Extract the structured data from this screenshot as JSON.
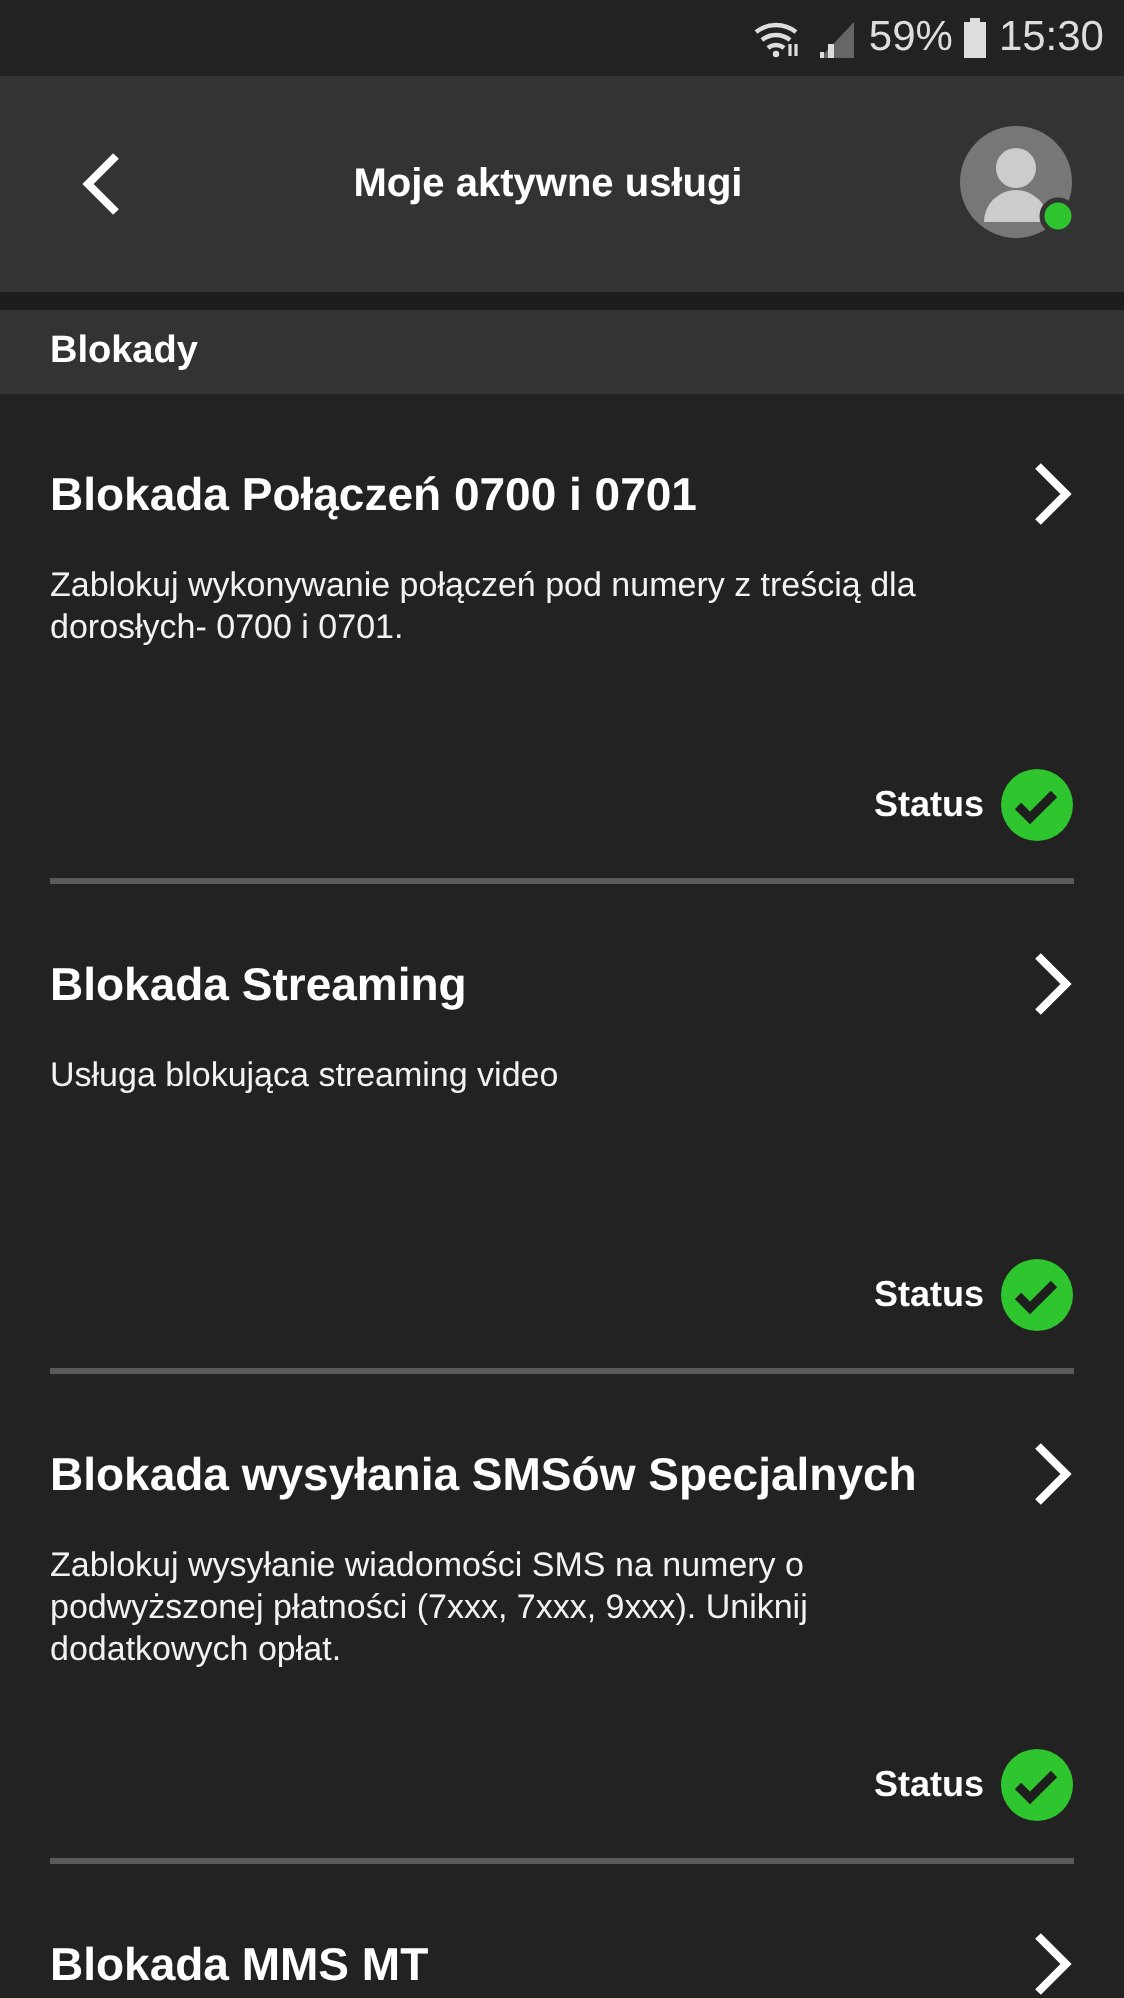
{
  "status_bar": {
    "battery_percent": "59%",
    "time": "15:30"
  },
  "header": {
    "title": "Moje aktywne usługi",
    "avatar": {
      "online": true
    }
  },
  "section": {
    "title": "Blokady"
  },
  "services": [
    {
      "title": "Blokada Połączeń 0700 i 0701",
      "description": "Zablokuj wykonywanie połączeń pod numery z treścią dla dorosłych- 0700 i 0701.",
      "status_label": "Status",
      "active": true
    },
    {
      "title": "Blokada Streaming",
      "description": "Usługa blokująca streaming video",
      "status_label": "Status",
      "active": true
    },
    {
      "title": "Blokada wysyłania SMSów Specjalnych",
      "description": "Zablokuj wysyłanie wiadomości SMS na numery o podwyższonej płatności (7xxx, 7xxx, 9xxx). Uniknij dodatkowych opłat.",
      "status_label": "Status",
      "active": true
    },
    {
      "title": "Blokada MMS MT"
    }
  ]
}
